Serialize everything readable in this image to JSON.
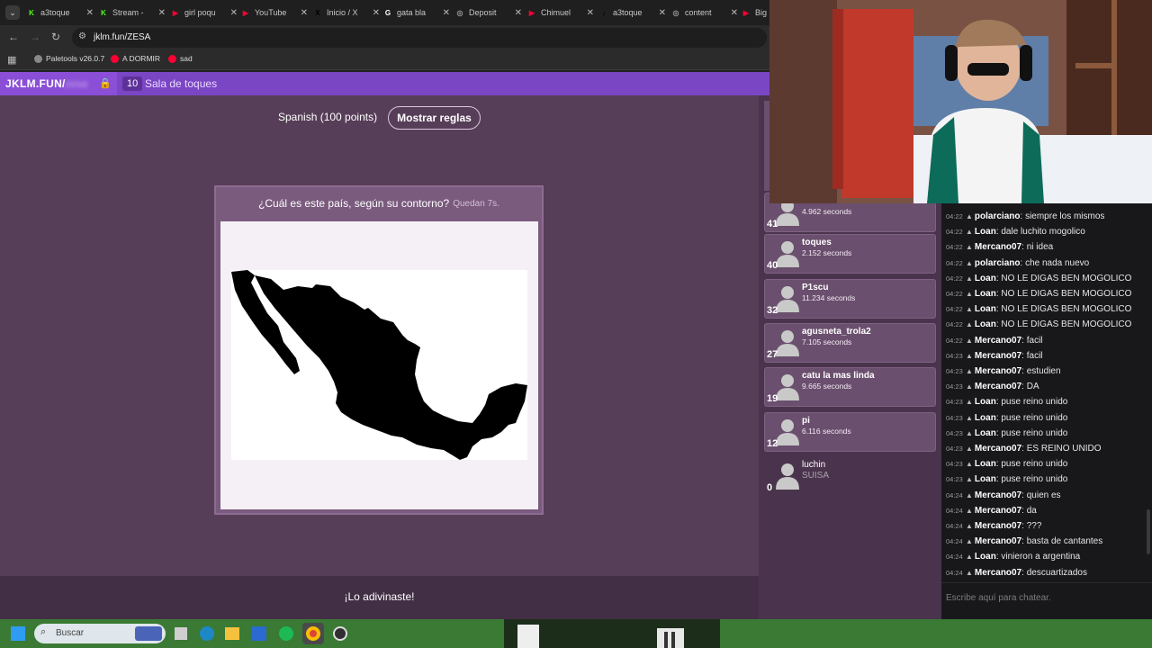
{
  "browser": {
    "tabs": [
      {
        "label": "a3toque",
        "fav": "K",
        "color": "#53fc18"
      },
      {
        "label": "Stream -",
        "fav": "K",
        "color": "#53fc18"
      },
      {
        "label": "girl poqu",
        "fav": "▶",
        "color": "#ff0033"
      },
      {
        "label": "YouTube",
        "fav": "▶",
        "color": "#ff0033"
      },
      {
        "label": "Inicio / X",
        "fav": "X",
        "color": "#000000"
      },
      {
        "label": "gata bla",
        "fav": "G",
        "color": "#ffffff"
      },
      {
        "label": "Deposit",
        "fav": "◎",
        "color": "#999999"
      },
      {
        "label": "Chimuel",
        "fav": "▶",
        "color": "#ff0033"
      },
      {
        "label": "a3toque",
        "fav": "♪",
        "color": "#000000"
      },
      {
        "label": "content",
        "fav": "◎",
        "color": "#999999"
      },
      {
        "label": "Big",
        "fav": "▶",
        "color": "#ff0033"
      }
    ],
    "url": "jklm.fun/ZESA",
    "bookmarks": [
      {
        "label": "Paletools v26.0.7",
        "color": "#888888"
      },
      {
        "label": "A DORMIR",
        "color": "#ff0033"
      },
      {
        "label": "sad",
        "color": "#ff0033"
      }
    ]
  },
  "site": {
    "brand": "JKLM.FUN/",
    "brand_masked": "zesa",
    "room_count": "10",
    "room_name": "Sala de toques"
  },
  "game": {
    "language": "Spanish (100 points)",
    "rules_button": "Mostrar reglas",
    "question": "¿Cuál es este país, según su contorno?",
    "timer": "Quedan 7s.",
    "status": "¡Lo adivinaste!"
  },
  "players": [
    {
      "rank": "41",
      "name": "",
      "time": "4.962 seconds"
    },
    {
      "rank": "40",
      "name": "toques",
      "time": "2.152 seconds"
    },
    {
      "rank": "32",
      "name": "P1scu",
      "time": "11.234 seconds"
    },
    {
      "rank": "27",
      "name": "agusneta_trola2",
      "time": "7.105 seconds"
    },
    {
      "rank": "19",
      "name": "catu la mas linda",
      "time": "9.665 seconds"
    },
    {
      "rank": "12",
      "name": "pi",
      "time": "6.116 seconds"
    },
    {
      "rank": "0",
      "name": "luchin",
      "time": "SUISA"
    }
  ],
  "chat": {
    "messages": [
      {
        "time": "04:22",
        "user": "polarciano",
        "text": "siempre los mismos"
      },
      {
        "time": "04:22",
        "user": "Loan",
        "text": "dale luchito mogolico"
      },
      {
        "time": "04:22",
        "user": "Mercano07",
        "text": "ni idea"
      },
      {
        "time": "04:22",
        "user": "polarciano",
        "text": "che nada nuevo"
      },
      {
        "time": "04:22",
        "user": "Loan",
        "text": "NO LE DIGAS BEN MOGOLICO"
      },
      {
        "time": "04:22",
        "user": "Loan",
        "text": "NO LE DIGAS BEN MOGOLICO"
      },
      {
        "time": "04:22",
        "user": "Loan",
        "text": "NO LE DIGAS BEN MOGOLICO"
      },
      {
        "time": "04:22",
        "user": "Loan",
        "text": "NO LE DIGAS BEN MOGOLICO"
      },
      {
        "time": "04:22",
        "user": "Mercano07",
        "text": "facil"
      },
      {
        "time": "04:23",
        "user": "Mercano07",
        "text": "facil"
      },
      {
        "time": "04:23",
        "user": "Mercano07",
        "text": "estudien"
      },
      {
        "time": "04:23",
        "user": "Mercano07",
        "text": "DA"
      },
      {
        "time": "04:23",
        "user": "Loan",
        "text": "puse reino unido"
      },
      {
        "time": "04:23",
        "user": "Loan",
        "text": "puse reino unido"
      },
      {
        "time": "04:23",
        "user": "Loan",
        "text": "puse reino unido"
      },
      {
        "time": "04:23",
        "user": "Mercano07",
        "text": "ES REINO UNIDO"
      },
      {
        "time": "04:23",
        "user": "Loan",
        "text": "puse reino unido"
      },
      {
        "time": "04:23",
        "user": "Loan",
        "text": "puse reino unido"
      },
      {
        "time": "04:24",
        "user": "Mercano07",
        "text": "quien es"
      },
      {
        "time": "04:24",
        "user": "Mercano07",
        "text": "da"
      },
      {
        "time": "04:24",
        "user": "Mercano07",
        "text": "???"
      },
      {
        "time": "04:24",
        "user": "Mercano07",
        "text": "basta de cantantes"
      },
      {
        "time": "04:24",
        "user": "Loan",
        "text": "vinieron a argentina"
      },
      {
        "time": "04:24",
        "user": "Mercano07",
        "text": "descuartizados"
      }
    ],
    "placeholder": "Escribe aquí para chatear."
  },
  "taskbar": {
    "search_placeholder": "Buscar"
  }
}
